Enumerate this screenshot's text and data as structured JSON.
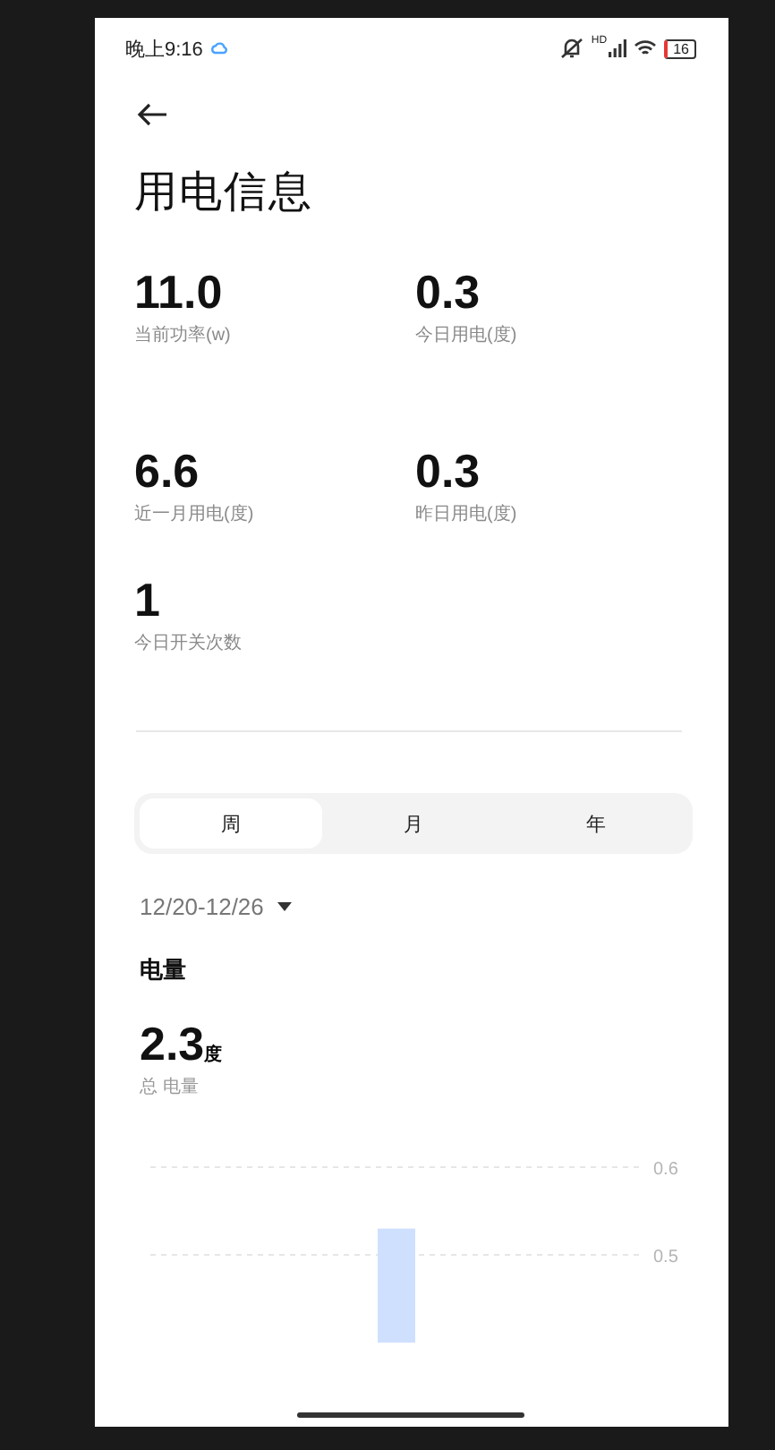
{
  "status_bar": {
    "time": "晚上9:16",
    "network_badge": "HD",
    "battery": "16"
  },
  "title": "用电信息",
  "stats": [
    {
      "value": "11.0",
      "label": "当前功率(w)"
    },
    {
      "value": "0.3",
      "label": "今日用电(度)"
    },
    {
      "value": "6.6",
      "label": "近一月用电(度)"
    },
    {
      "value": "0.3",
      "label": "昨日用电(度)"
    },
    {
      "value": "1",
      "label": "今日开关次数"
    }
  ],
  "tabs": [
    {
      "label": "周",
      "selected": true
    },
    {
      "label": "月",
      "selected": false
    },
    {
      "label": "年",
      "selected": false
    }
  ],
  "date_range": "12/20-12/26",
  "section_title": "电量",
  "total": {
    "value": "2.3",
    "unit": "度",
    "label": "总 电量"
  },
  "chart_data": {
    "type": "bar",
    "ylim": [
      0.4,
      0.6
    ],
    "yticks": [
      0.5,
      0.6
    ],
    "series": [
      {
        "color": "#cfe0ff",
        "values": [
          null,
          null,
          null,
          0.53,
          null,
          null,
          null
        ]
      }
    ]
  }
}
